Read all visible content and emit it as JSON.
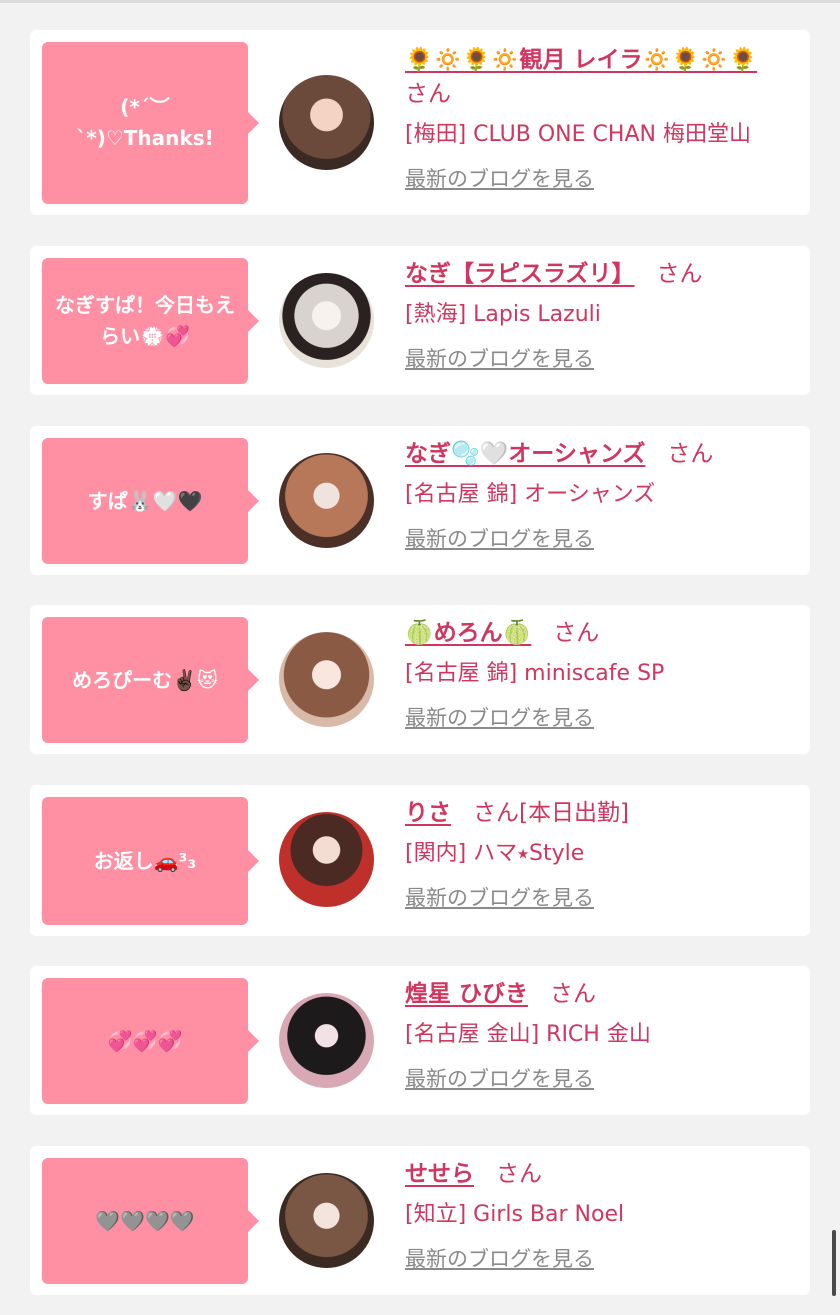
{
  "blog_link_label": "最新のブログを見る",
  "san_label": "さん",
  "colors": {
    "accent": "#d0365f",
    "bubble": "#ff8fa3",
    "background": "#f2f2f2"
  },
  "cards": [
    {
      "bubble": "(*´︶`*)♡Thanks!",
      "name": "🌻🔅🌻🔅観月 レイラ🔅🌻🔅🌻",
      "extra": "",
      "shop": "[梅田] CLUB ONE CHAN 梅田堂山"
    },
    {
      "bubble": "なぎすぱ！今日もえらい💮💞",
      "name": "なぎ【ラピスラズリ】",
      "extra": "",
      "shop": "[熱海] Lapis Lazuli"
    },
    {
      "bubble": "すぱ🐰🤍🖤",
      "name": "なぎ🫧🤍オーシャンズ",
      "extra": "",
      "shop": "[名古屋 錦] オーシャンズ"
    },
    {
      "bubble": "めろぴーむ✌🏿😻",
      "name": "🍈めろん🍈",
      "extra": "",
      "shop": "[名古屋 錦] miniscafe SP"
    },
    {
      "bubble": "お返し🚗³₃",
      "name": "りさ",
      "extra": "[本日出勤]",
      "shop": "[関内] ハマ⭑Style"
    },
    {
      "bubble": "💞💞💞",
      "name": "煌星 ひびき",
      "extra": "",
      "shop": "[名古屋 金山] RICH 金山"
    },
    {
      "bubble": "🩶🩶🩶🩶",
      "name": "せせら",
      "extra": "",
      "shop": "[知立] Girls Bar Noel"
    }
  ]
}
